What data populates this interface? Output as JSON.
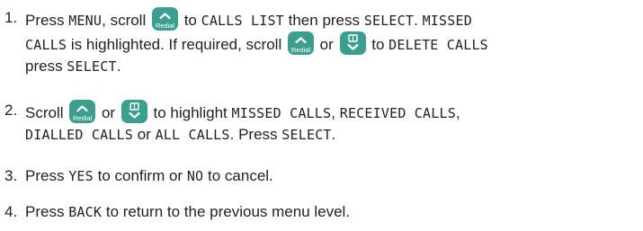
{
  "colors": {
    "key_background": "#3b9f8f",
    "key_foreground": "#ffffff",
    "text": "#222222"
  },
  "icons": {
    "up_key": "chevron-up-redial-key",
    "down_key": "phonebook-chevron-down-key"
  },
  "steps": [
    {
      "number": "1.",
      "segments": {
        "s1": "Press ",
        "s2": "MENU",
        "s3": ", scroll ",
        "s4": " to ",
        "s5": "CALLS LIST",
        "s6": " then press ",
        "s7": "SELECT",
        "s8": ". ",
        "s9": "MISSED",
        "s10": "CALLS",
        "s11": " is highlighted. If required, scroll ",
        "s12": " or ",
        "s13": " to ",
        "s14": "DELETE CALLS",
        "s15": "press ",
        "s16": "SELECT",
        "s17": "."
      }
    },
    {
      "number": "2.",
      "segments": {
        "s1": "Scroll ",
        "s2": " or ",
        "s3": " to highlight ",
        "s4": "MISSED CALLS",
        "s5": ", ",
        "s6": "RECEIVED CALLS",
        "s7": ",",
        "s8": "DIALLED CALLS",
        "s9": " or ",
        "s10": "ALL CALLS",
        "s11": ". Press ",
        "s12": "SELECT",
        "s13": "."
      }
    },
    {
      "number": "3.",
      "segments": {
        "s1": "Press ",
        "s2": "YES",
        "s3": " to confirm or ",
        "s4": "NO",
        "s5": " to cancel."
      }
    },
    {
      "number": "4.",
      "segments": {
        "s1": "Press ",
        "s2": "BACK",
        "s3": " to return to the previous menu level."
      }
    }
  ],
  "keys": {
    "redial_label": "Redial"
  }
}
